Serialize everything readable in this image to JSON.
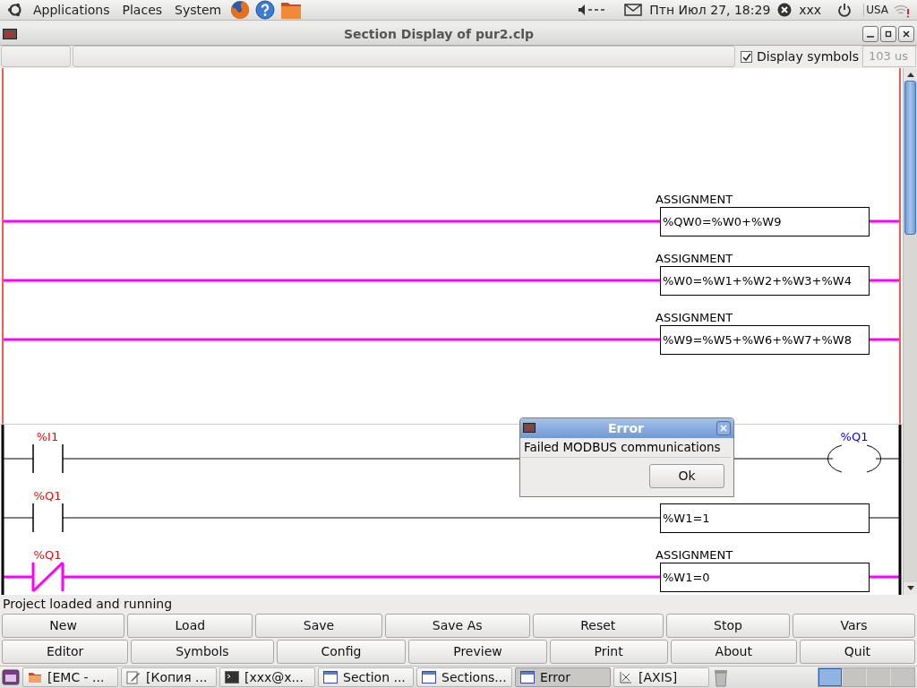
{
  "top_panel": {
    "menus": [
      "Applications",
      "Places",
      "System"
    ],
    "clock": "Птн Июл 27, 18:29",
    "user": "xxx",
    "keyboard_layout": "USA"
  },
  "window": {
    "title": "Section Display of pur2.clp"
  },
  "toolbar": {
    "display_symbols": {
      "label": "Display symbols",
      "checked": true
    },
    "cycle_time": "103 us"
  },
  "sections": [
    {
      "color": "#f05a5a",
      "rungs": [
        {
          "energized": true,
          "block": {
            "title": "ASSIGNMENT",
            "expression": "%QW0=%W0+%W9"
          }
        },
        {
          "energized": true,
          "block": {
            "title": "ASSIGNMENT",
            "expression": "%W0=%W1+%W2+%W3+%W4"
          }
        },
        {
          "energized": true,
          "block": {
            "title": "ASSIGNMENT",
            "expression": "%W9=%W5+%W6+%W7+%W8"
          }
        }
      ]
    },
    {
      "color": "#000000",
      "rungs": [
        {
          "energized": false,
          "contact": {
            "label": "%I1",
            "normally_closed": false
          },
          "coil": {
            "label": "%Q1"
          }
        },
        {
          "energized": false,
          "contact": {
            "label": "%Q1",
            "normally_closed": false
          },
          "block": {
            "expression": "%W1=1"
          }
        },
        {
          "energized": true,
          "contact": {
            "label": "%Q1",
            "normally_closed": true
          },
          "block": {
            "title": "ASSIGNMENT",
            "expression": "%W1=0"
          }
        }
      ]
    }
  ],
  "dialog": {
    "title": "Error",
    "message": "Failed MODBUS communications",
    "button": "Ok"
  },
  "status_bar": "Project loaded and running",
  "button_rows": [
    [
      "New",
      "Load",
      "Save",
      "Save As",
      "Reset",
      "Stop",
      "Vars"
    ],
    [
      "Editor",
      "Symbols",
      "Config",
      "Preview",
      "Print",
      "About",
      "Quit"
    ]
  ],
  "taskbar": {
    "items": [
      {
        "kind": "folder",
        "label": "[EMC - ...",
        "selected": false
      },
      {
        "kind": "editor",
        "label": "[Копия ...",
        "selected": false
      },
      {
        "kind": "terminal",
        "label": "[xxx@x...",
        "selected": false
      },
      {
        "kind": "window",
        "label": "Section ...",
        "selected": false
      },
      {
        "kind": "window",
        "label": "Sections...",
        "selected": false
      },
      {
        "kind": "window",
        "label": "Error",
        "selected": true
      },
      {
        "kind": "graph",
        "label": "[AXIS]",
        "selected": false
      }
    ]
  }
}
